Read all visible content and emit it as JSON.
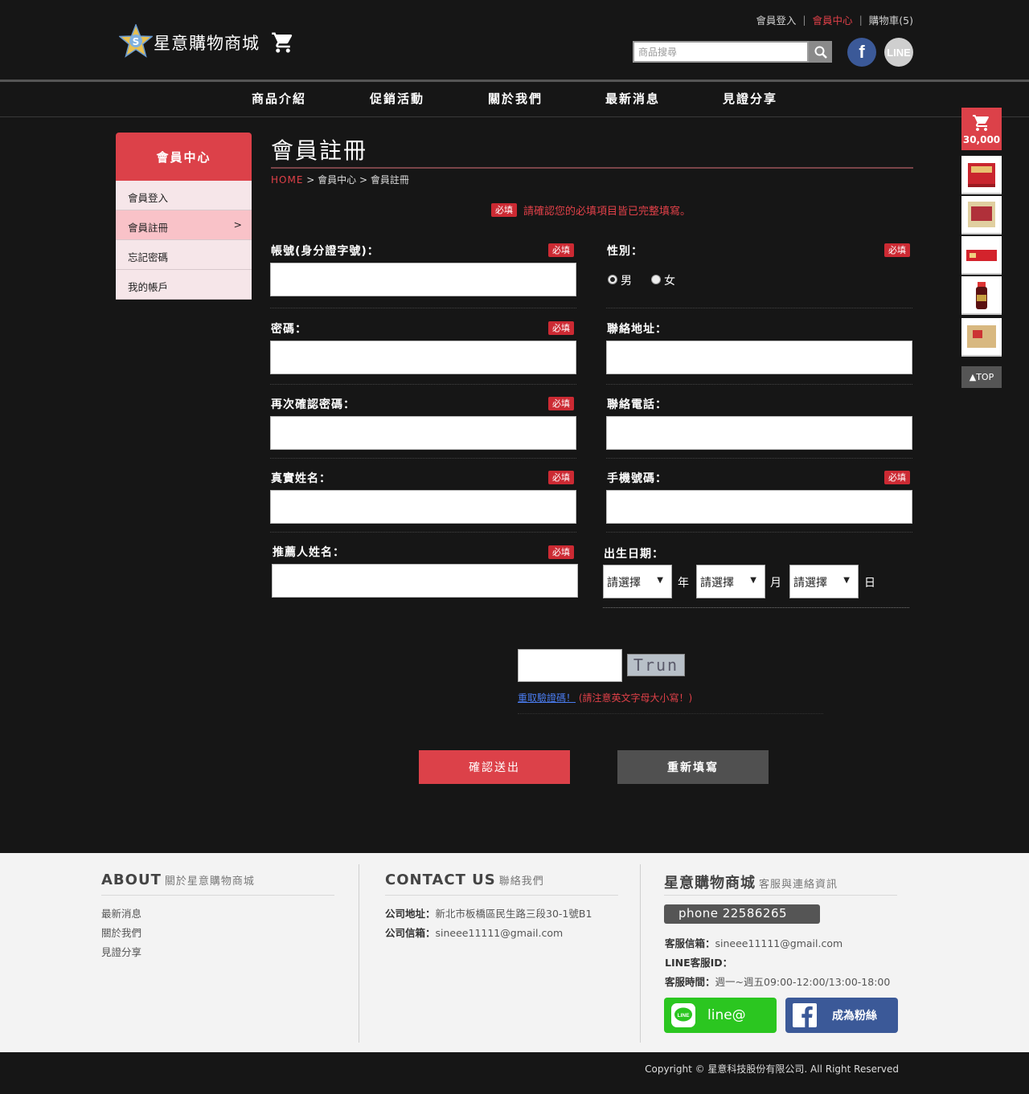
{
  "header": {
    "site_name": "星意購物商城",
    "top_links": [
      "會員登入",
      "會員中心",
      "購物車(5)"
    ],
    "search_placeholder": "商品搜尋",
    "line_label": "LINE"
  },
  "nav": {
    "items": [
      "商品介紹",
      "促銷活動",
      "關於我們",
      "最新消息",
      "見證分享"
    ]
  },
  "sidebar": {
    "heading": "會員中心",
    "items": [
      {
        "label": "會員登入"
      },
      {
        "label": "會員註冊",
        "arrow": ">"
      },
      {
        "label": "忘記密碼"
      },
      {
        "label": "我的帳戶"
      }
    ]
  },
  "main": {
    "title": "會員註冊",
    "breadcrumb": {
      "home": "HOME",
      "sep": ">",
      "level1": "會員中心",
      "level2": "會員註冊"
    },
    "required_badge": "必填",
    "notice": "請確認您的必填項目皆已完整填寫。",
    "fields": {
      "account": "帳號(身分證字號)：",
      "gender": "性別：",
      "password": "密碼：",
      "address": "聯絡地址：",
      "confirm_password": "再次確認密碼：",
      "phone": "聯絡電話：",
      "real_name": "真實姓名：",
      "mobile": "手機號碼：",
      "referrer": "推薦人姓名：",
      "birthday": "出生日期："
    },
    "gender_options": [
      "男",
      "女"
    ],
    "gender_selected": "男",
    "birthday_select": {
      "placeholder": "請選擇",
      "arrow": "▼",
      "units": [
        "年",
        "月",
        "日"
      ]
    },
    "captcha": {
      "text": "Trun",
      "refresh_label": "重取驗證碼！",
      "note": "(請注意英文字母大小寫！)"
    },
    "buttons": {
      "submit": "確認送出",
      "reset": "重新填寫"
    }
  },
  "float_cart": {
    "amount": "30,000",
    "top_label": "▲TOP"
  },
  "footer": {
    "about": {
      "title": "ABOUT",
      "subtitle": "關於星意購物商城",
      "links": [
        "最新消息",
        "關於我們",
        "見證分享"
      ]
    },
    "contact": {
      "title": "CONTACT US",
      "subtitle": "聯絡我們",
      "address_label": "公司地址：",
      "address": "新北市板橋區民生路三段30-1號B1",
      "email_label": "公司信箱：",
      "email": "sineee11111@gmail.com"
    },
    "service": {
      "title": "星意購物商城",
      "subtitle": "客服與連絡資訊",
      "phone": "phone 22586265",
      "email_label": "客服信箱：",
      "email": "sineee11111@gmail.com",
      "line_label": "LINE客服ID：",
      "hours_label": "客服時間：",
      "hours": "週一~週五09:00-12:00/13:00-18:00",
      "line_button": "line@",
      "fb_button": "成為粉絲"
    },
    "copyright": "Copyright © 星意科技股份有限公司. All Right Reserved"
  },
  "colors": {
    "accent": "#dc4149",
    "background": "#161616",
    "footer_bg": "#f3f3f3",
    "line_green": "#2bc620",
    "facebook_blue": "#3b5998"
  }
}
